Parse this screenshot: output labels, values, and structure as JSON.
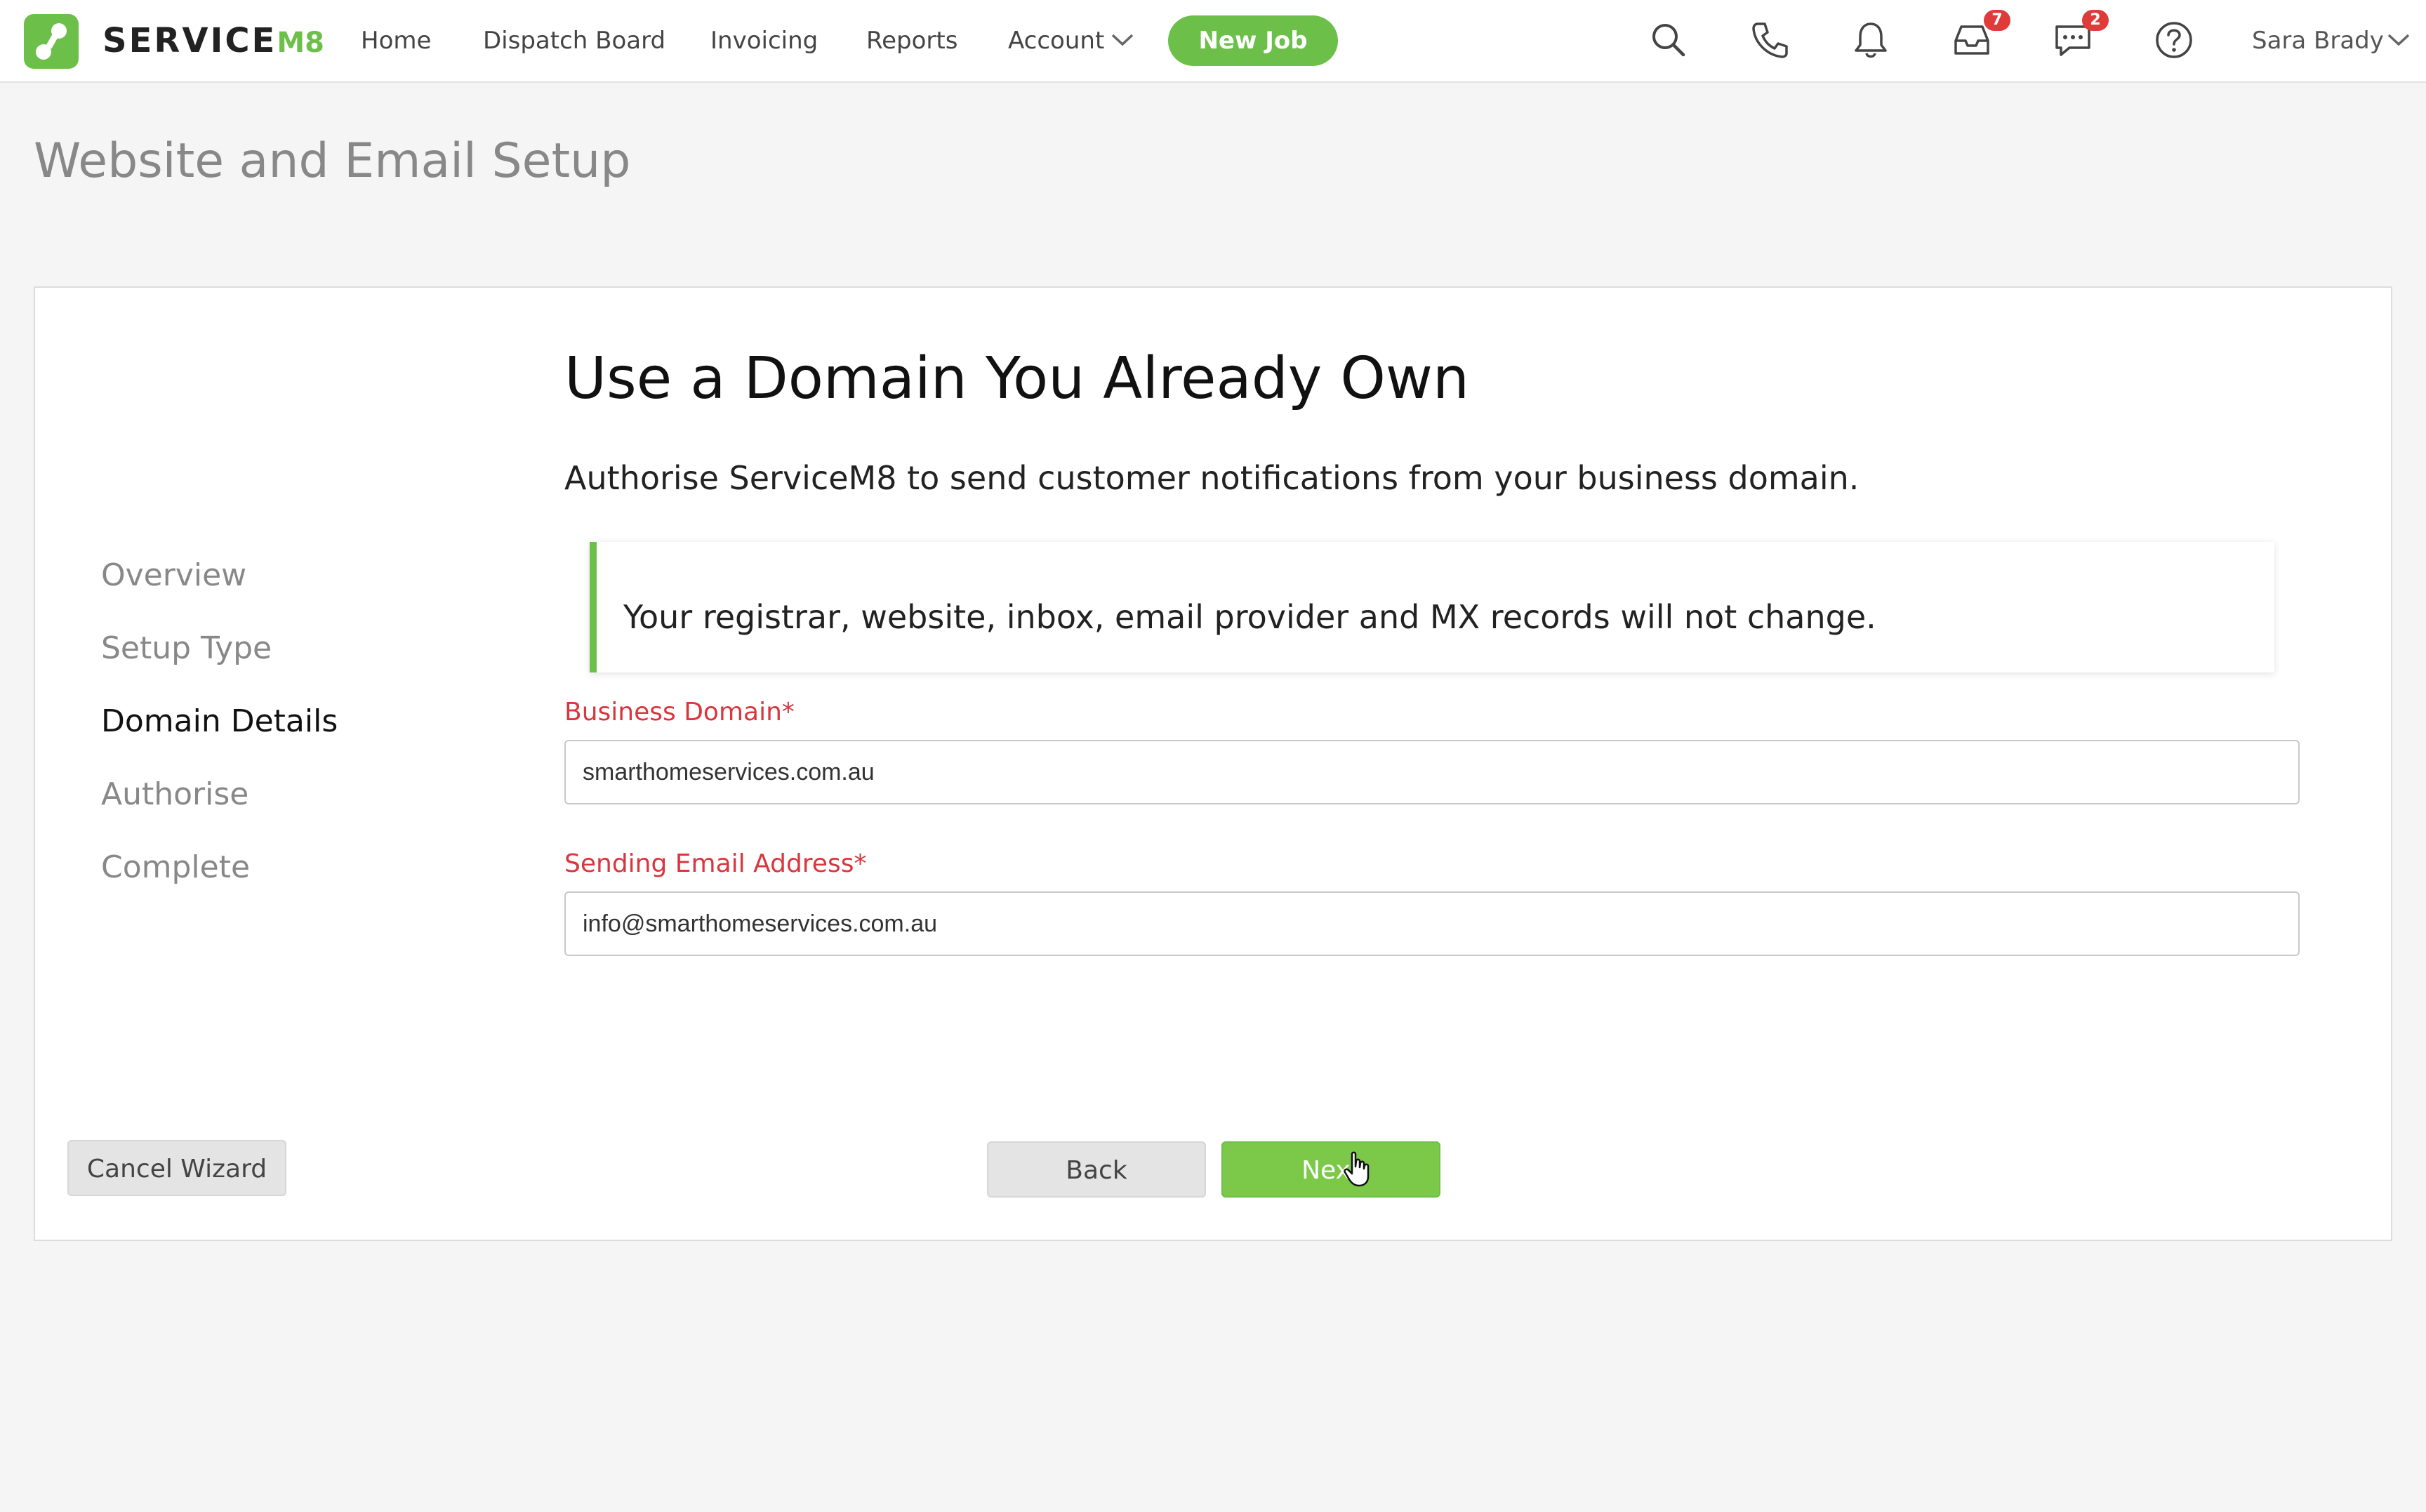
{
  "app": {
    "brand_name": "SERVICE",
    "brand_suffix": "M8"
  },
  "nav": {
    "items": [
      "Home",
      "Dispatch Board",
      "Invoicing",
      "Reports",
      "Account"
    ],
    "new_job_label": "New Job",
    "icons": {
      "search": "search-icon",
      "phone": "phone-icon",
      "notifications": "bell-icon",
      "inbox": "inbox-icon",
      "messages": "chat-icon",
      "help": "help-icon"
    },
    "badges": {
      "inbox": "7",
      "messages": "2"
    },
    "user_name": "Sara Brady"
  },
  "page": {
    "title": "Website and Email Setup"
  },
  "wizard": {
    "steps": [
      "Overview",
      "Setup Type",
      "Domain Details",
      "Authorise",
      "Complete"
    ],
    "active_step": "Domain Details",
    "heading": "Use a Domain You Already Own",
    "subtext": "Authorise ServiceM8 to send customer notifications from your business domain.",
    "callout": "Your registrar, website, inbox, email provider and MX records will not change.",
    "fields": {
      "business_domain": {
        "label": "Business Domain*",
        "value": "smarthomeservices.com.au"
      },
      "sending_email": {
        "label": "Sending Email Address*",
        "value": "info@smarthomeservices.com.au"
      }
    },
    "buttons": {
      "cancel": "Cancel Wizard",
      "back": "Back",
      "next": "Next"
    }
  },
  "colors": {
    "brand_green": "#6cc04a",
    "label_red": "#d9363e",
    "badge_red": "#e03b3b"
  }
}
